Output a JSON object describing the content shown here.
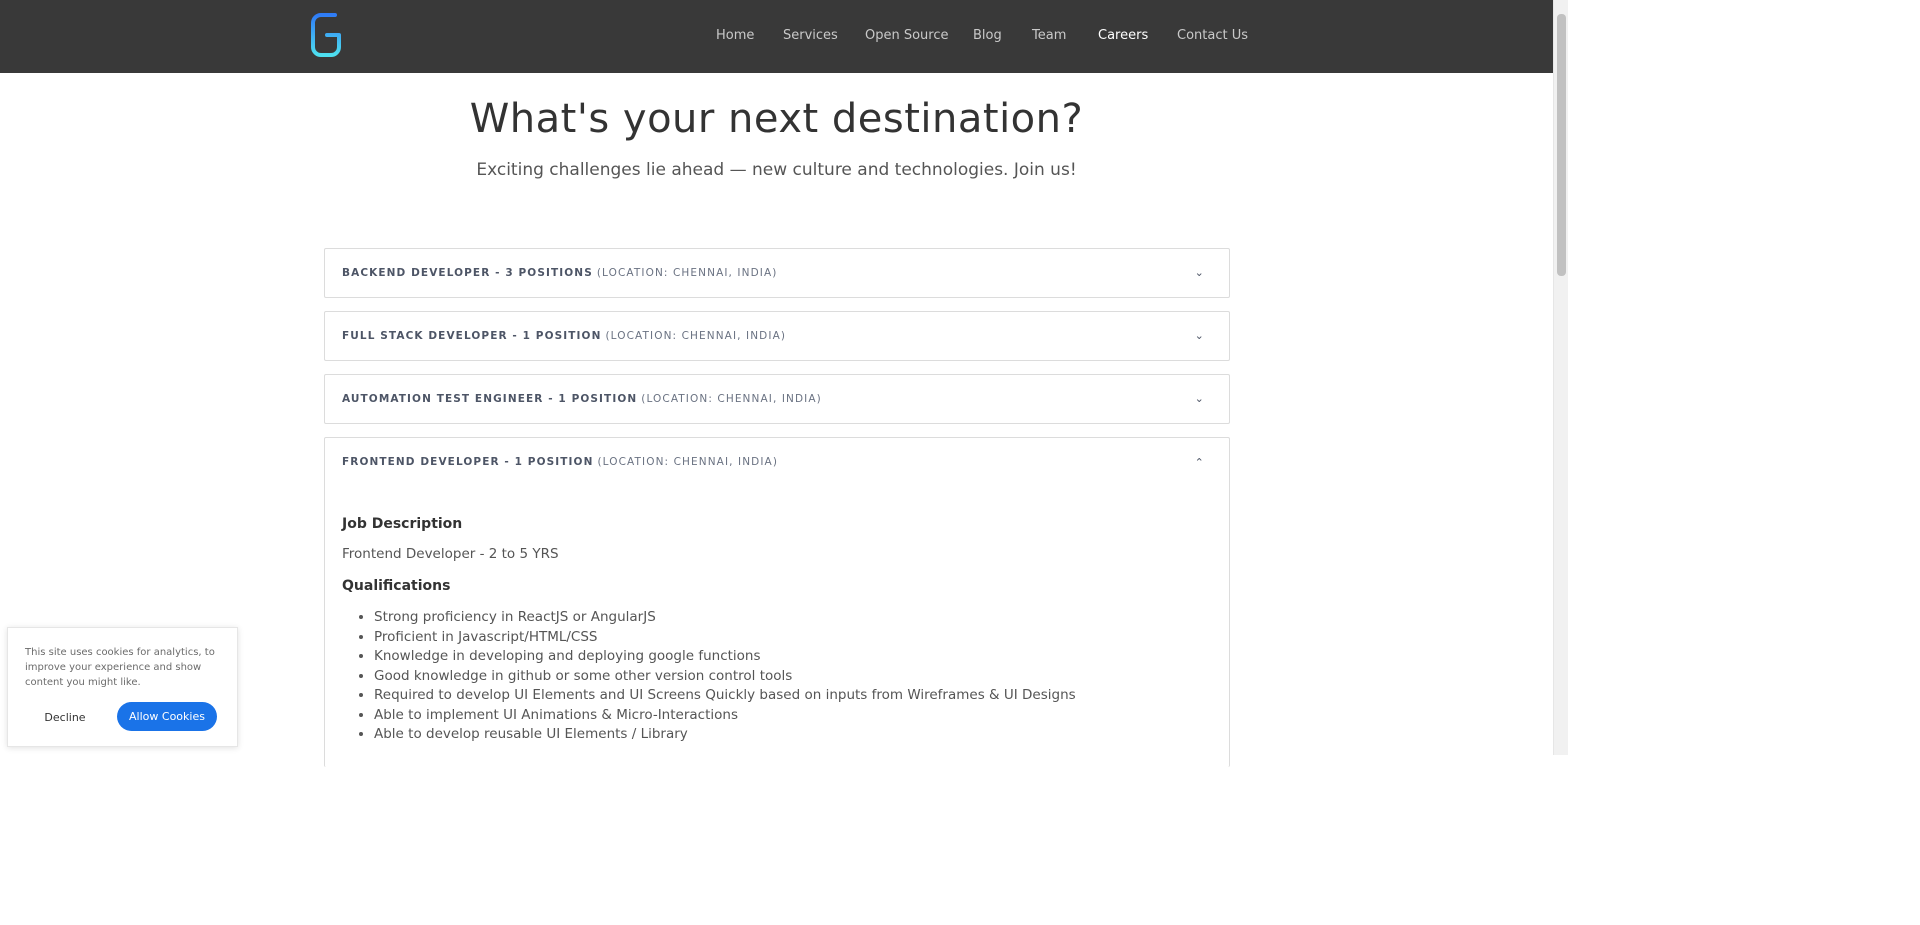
{
  "header": {
    "logo_icon": "g-logo-icon",
    "nav": [
      {
        "label": "Home"
      },
      {
        "label": "Services"
      },
      {
        "label": "Open Source"
      },
      {
        "label": "Blog"
      },
      {
        "label": "Team"
      },
      {
        "label": "Careers"
      },
      {
        "label": "Contact Us"
      }
    ]
  },
  "hero": {
    "title": "What's your next destination?",
    "subtitle": "Exciting challenges lie ahead — new culture and technologies. Join us!"
  },
  "jobs": [
    {
      "title": "BACKEND DEVELOPER - 3 POSITIONS",
      "location": "(LOCATION: CHENNAI, INDIA)"
    },
    {
      "title": "FULL STACK DEVELOPER - 1 POSITION",
      "location": "(LOCATION: CHENNAI, INDIA)"
    },
    {
      "title": "AUTOMATION TEST ENGINEER - 1 POSITION",
      "location": "(LOCATION: CHENNAI, INDIA)"
    },
    {
      "title": "FRONTEND DEVELOPER - 1 POSITION",
      "location": "(LOCATION: CHENNAI, INDIA)",
      "job_description_heading": "Job Description",
      "job_description": "Frontend Developer - 2 to 5 YRS",
      "qualifications_heading": "Qualifications",
      "qualifications": [
        "Strong proficiency in ReactJS or AngularJS",
        "Proficient in Javascript/HTML/CSS",
        "Knowledge in developing and deploying google functions",
        "Good knowledge in github or some other version control tools",
        "Required to develop UI Elements and UI Screens Quickly based on inputs from Wireframes & UI Designs",
        "Able to implement UI Animations & Micro-Interactions",
        "Able to develop reusable UI Elements / Library"
      ]
    }
  ],
  "cookie": {
    "text": "This site uses cookies for analytics, to improve your experience and show content you might like.",
    "decline_label": "Decline",
    "allow_label": "Allow Cookies"
  },
  "colors": {
    "header_bg": "#393939",
    "accent": "#1a73e8",
    "logo_gradient_top": "#2f7cf6",
    "logo_gradient_bottom": "#4ee0f0"
  }
}
